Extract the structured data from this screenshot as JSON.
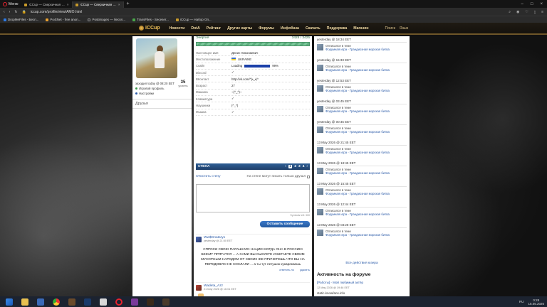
{
  "browser": {
    "menu_label": "Меню",
    "tabs": [
      {
        "title": "iCCup — Сверхичная инфо",
        "active": false
      },
      {
        "title": "iCCup — Сверхичная инфо",
        "active": true
      },
      {
        "title": "",
        "active": false
      }
    ],
    "url": "iccup.com/profile/view/AMO.html",
    "bookmarks": [
      "DropMeFiles - Бесп...",
      "Po4tNet - free anon...",
      "Postimages — беспл...",
      "TransFiles - Seceser...",
      "iCCup — Набор Оп..."
    ]
  },
  "site": {
    "logo": "iCCup",
    "nav": [
      "Новости",
      "DotA",
      "Рейтинг",
      "Другие карты",
      "Форумы",
      "Инфобаза",
      "Скачать",
      "Поддержка",
      "Магазин"
    ],
    "search_label": "Поиск",
    "lang_label": "Язык"
  },
  "profile": {
    "level": "35",
    "level_caption": "уровень",
    "last_seen": "заходил today @ 08:20 EET",
    "links": [
      "Игровой профиль",
      "Настройки"
    ],
    "friends_label": "Друзья"
  },
  "energy": {
    "label": "Энергия",
    "value": "3425 / 3425",
    "fill_fraction": 1.0
  },
  "info": [
    {
      "k": "Настоящее имя",
      "v": "Денис Николаевич"
    },
    {
      "k": "Местоположение",
      "v": "UKRAINE"
    },
    {
      "k": "Скайп",
      "v": "Loading"
    },
    {
      "k": "Discord",
      "v": "✓"
    },
    {
      "k": "ВКонтакт",
      "v": "http://vk.com/^(•_•)^"
    },
    {
      "k": "Возраст",
      "v": "27"
    },
    {
      "k": "Машина",
      "v": "~(^_^)~"
    },
    {
      "k": "Клавиатура",
      "v": "✓"
    },
    {
      "k": "Наушники",
      "v": "(^_^)"
    },
    {
      "k": "Мышка",
      "v": "✓"
    }
  ],
  "skype_percent": "99%",
  "wall": {
    "title": "СТЕНА",
    "pages": [
      "1",
      "2",
      "3",
      "4"
    ],
    "current_page": "1",
    "clear_label": "Очистить стену",
    "restrict_label": "На стене могут писать только друзья",
    "chars_left": "Symbols left: 300",
    "send_label": "Оставить сообщение",
    "posts": [
      {
        "user": "Ww$Gnataryx",
        "date": "yesterday @ 21:50 EET",
        "body": "СПРОСИ СВОЮ ПАРАШНУЮ НАЦИЮ КОГДА ОНА В РОССИЮ БЕЖИТ ПРЯТАТСЯ ... А САМИ ВЫ СЫКУЕТЕ И БЕГАЕТЕ СВОИМ МУСОРНЫМ НАРОДОМ ОТ СВОИХ ЖЕ ПРИЧЕТЕШЬ ЧТО ВЫ НА ПЕРЕДОВУЮ НЕ СОСЛАЛИ ... а ты тут петушок кукарекаешь",
        "actions": [
          "ответить.ло",
          "удалить"
        ]
      },
      {
        "user": "Wadeta_Azz",
        "date": "21 May 2026 @ 16:01 EET",
        "body": "",
        "actions": []
      }
    ]
  },
  "activity": [
    {
      "when": "yesterday @ 18:34 EET"
    },
    {
      "when": "yesterday @ 15:33 EET"
    },
    {
      "when": "yesterday @ 12:53 EET"
    },
    {
      "when": "yesterday @ 03:45 EET"
    },
    {
      "when": "yesterday @ 00:45 EET"
    },
    {
      "when": "13 May 2026 @ 21:45 EET"
    },
    {
      "when": "13 May 2026 @ 18:45 EET"
    },
    {
      "when": "13 May 2026 @ 15:45 EET"
    },
    {
      "when": "13 May 2026 @ 12:44 EET"
    },
    {
      "when": "13 May 2026 @ 03:28 EET"
    }
  ],
  "activity_text": {
    "line1": "Отписался в теме",
    "link": "Форумная игра - Грандиозная морская битва"
  },
  "all_actions": "Все действия юзера",
  "forum": {
    "heading": "Активность на форуме",
    "item": "[Работы] - Мой любимый актёр",
    "date": "12 May 2026 @ 19:46 EET",
    "stat": "static.knowfans.info"
  },
  "taskbar": {
    "lang": "RU",
    "time": "0:28",
    "date": "15.05.2026"
  }
}
